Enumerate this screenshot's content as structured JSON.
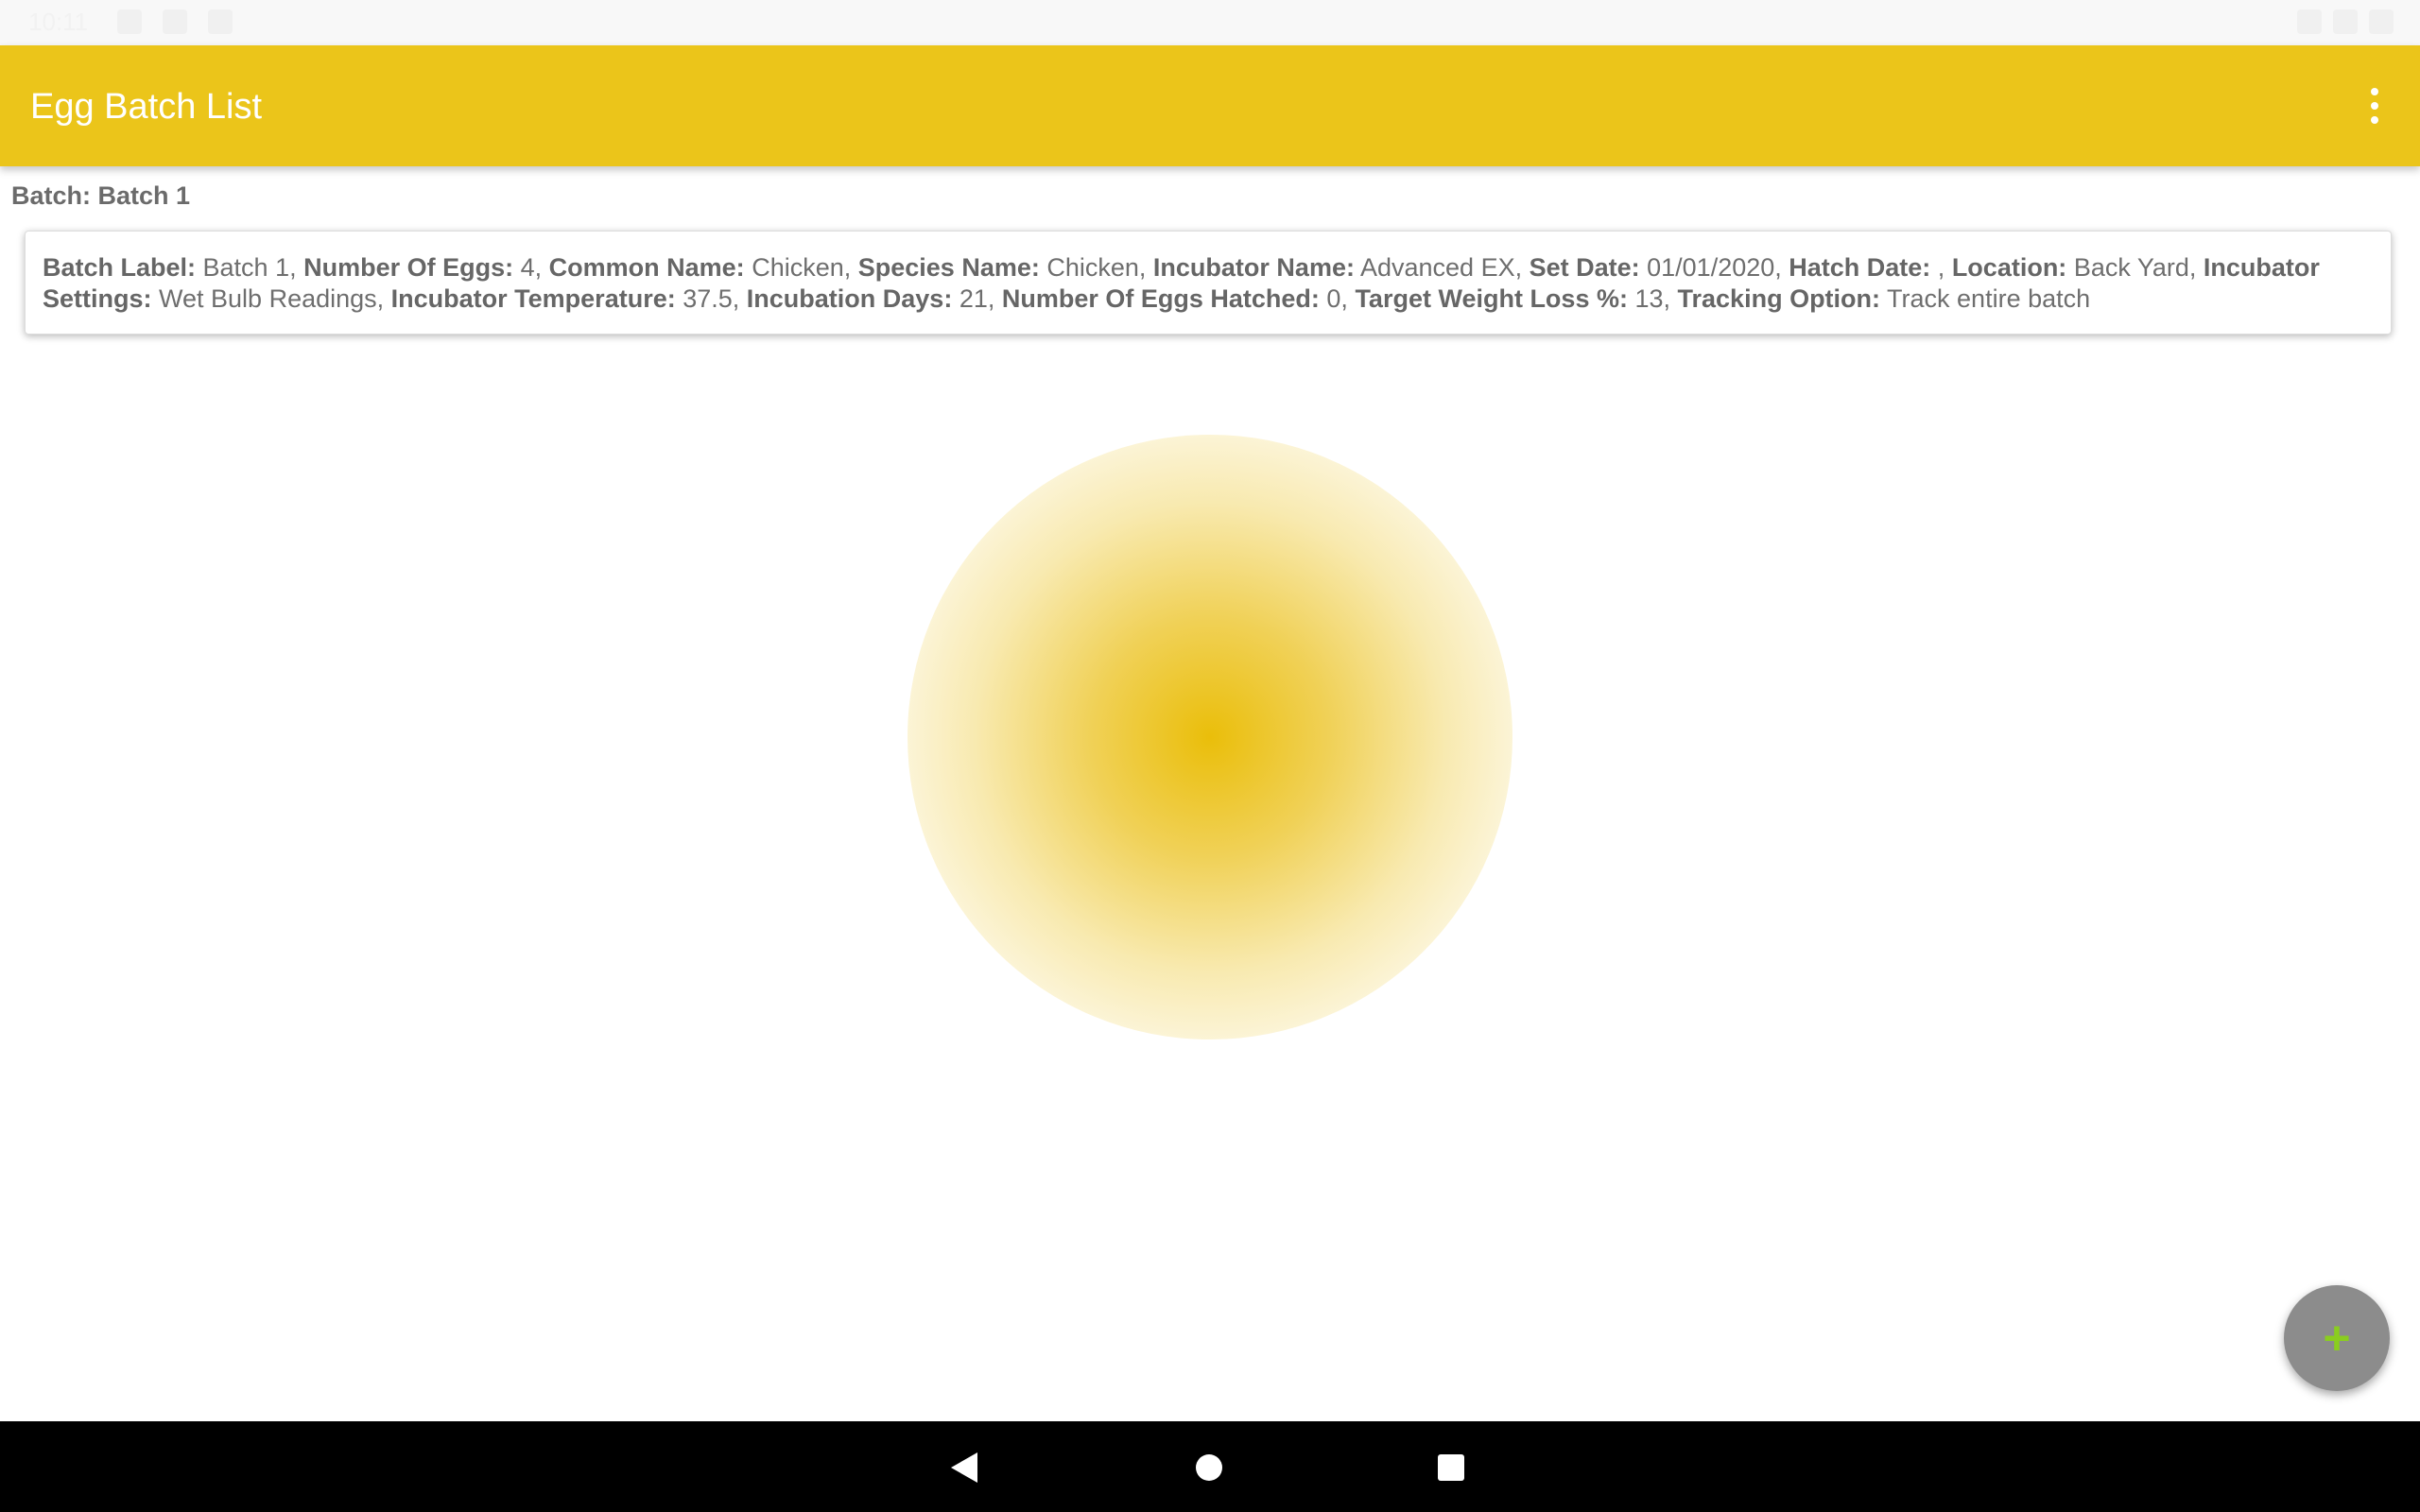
{
  "status_bar": {
    "time": "10:11",
    "left_icons": [
      "settings-icon",
      "image-icon",
      "sd-card-icon"
    ],
    "right_icons": [
      "wifi-icon",
      "signal-icon",
      "battery-icon"
    ]
  },
  "app_bar": {
    "title": "Egg Batch List",
    "menu_icon": "more-vert-icon",
    "color": "#ebc51a"
  },
  "batch_heading": "Batch: Batch 1",
  "batch_card": {
    "fields": [
      {
        "label": "Batch Label:",
        "value": " Batch 1, "
      },
      {
        "label": "Number Of Eggs:",
        "value": " 4, "
      },
      {
        "label": "Common Name:",
        "value": " Chicken, "
      },
      {
        "label": "Species Name:",
        "value": " Chicken, "
      },
      {
        "label": "Incubator Name:",
        "value": " Advanced EX, "
      },
      {
        "label": "Set Date:",
        "value": " 01/01/2020, "
      },
      {
        "label": "Hatch Date:",
        "value": " , "
      },
      {
        "label": "Location:",
        "value": " Back Yard, "
      },
      {
        "label": "Incubator Settings:",
        "value": " Wet Bulb Readings, "
      },
      {
        "label": "Incubator Temperature:",
        "value": " 37.5, "
      },
      {
        "label": "Incubation Days:",
        "value": " 21, "
      },
      {
        "label": "Number Of Eggs Hatched:",
        "value": " 0, "
      },
      {
        "label": "Target Weight Loss %:",
        "value": " 13, "
      },
      {
        "label": "Tracking Option:",
        "value": " Track entire batch"
      }
    ]
  },
  "fab": {
    "icon": "plus-icon",
    "symbol": "+"
  },
  "nav": {
    "back": "back-icon",
    "home": "home-icon",
    "recents": "recents-icon"
  }
}
